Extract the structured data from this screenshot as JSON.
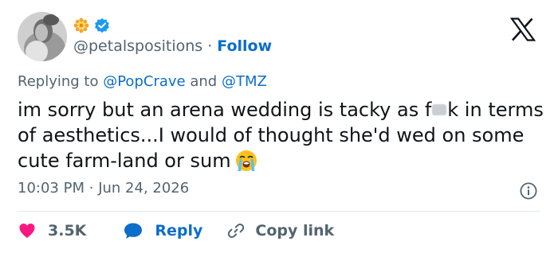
{
  "author": {
    "handle": "@petalspositions",
    "separator": "·",
    "follow_label": "Follow",
    "avatar_icon": "profile-photo",
    "badges": [
      "sunflower-icon",
      "verified-icon"
    ]
  },
  "reply_context": {
    "prefix": "Replying to",
    "mention1": "@PopCrave",
    "joiner": "and",
    "mention2": "@TMZ"
  },
  "tweet": {
    "text_before_censor": "im sorry but an arena wedding is tacky as f",
    "text_after_censor": "k in terms of aesthetics...I would of thought she'd wed on some cute farm-land or sum",
    "emoji": "loudly-crying-face-icon"
  },
  "meta": {
    "time": "10:03 PM",
    "separator": "·",
    "date": "Jun 24, 2026"
  },
  "actions": {
    "likes": "3.5K",
    "reply_label": "Reply",
    "copy_link_label": "Copy link"
  },
  "colors": {
    "accent_blue": "#0b6ec8",
    "like_red": "#f91880",
    "text_dark": "#0f1419",
    "text_gray": "#536471",
    "divider": "#e1e8ed"
  }
}
